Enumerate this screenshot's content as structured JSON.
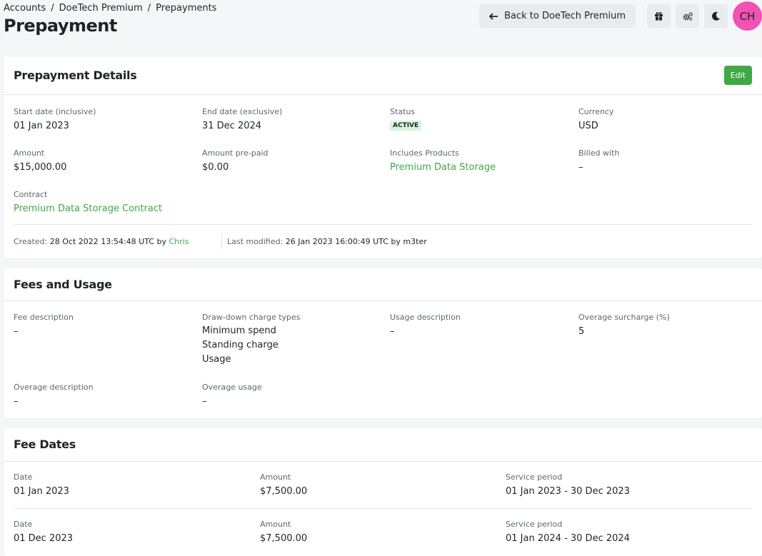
{
  "breadcrumb": [
    "Accounts",
    "DoeTech Premium",
    "Prepayments"
  ],
  "page_title": "Prepayment",
  "header": {
    "back_label": "Back to DoeTech Premium",
    "avatar_initials": "CH"
  },
  "details": {
    "title": "Prepayment Details",
    "edit_label": "Edit",
    "start_label": "Start date (inclusive)",
    "start_value": "01 Jan 2023",
    "end_label": "End date (exclusive)",
    "end_value": "31 Dec 2024",
    "status_label": "Status",
    "status_value": "ACTIVE",
    "currency_label": "Currency",
    "currency_value": "USD",
    "amount_label": "Amount",
    "amount_value": "$15,000.00",
    "prepaid_label": "Amount pre-paid",
    "prepaid_value": "$0.00",
    "products_label": "Includes Products",
    "products_value": "Premium Data Storage",
    "billed_label": "Billed with",
    "billed_value": "–",
    "contract_label": "Contract",
    "contract_value": "Premium Data Storage Contract",
    "created_label": "Created:",
    "created_value": "28 Oct 2022 13:54:48 UTC",
    "created_by_word": "by",
    "created_by": "Chris",
    "modified_label": "Last modified:",
    "modified_value": "26 Jan 2023 16:00:49 UTC by m3ter"
  },
  "fees": {
    "title": "Fees and Usage",
    "fee_desc_label": "Fee description",
    "fee_desc_value": "–",
    "drawdown_label": "Draw-down charge types",
    "drawdown_values": [
      "Minimum spend",
      "Standing charge",
      "Usage"
    ],
    "usage_desc_label": "Usage description",
    "usage_desc_value": "–",
    "surcharge_label": "Overage surcharge (%)",
    "surcharge_value": "5",
    "overage_desc_label": "Overage description",
    "overage_desc_value": "–",
    "overage_usage_label": "Overage usage",
    "overage_usage_value": "–"
  },
  "fee_dates": {
    "title": "Fee Dates",
    "rows": [
      {
        "date_label": "Date",
        "date": "01 Jan 2023",
        "amount_label": "Amount",
        "amount": "$7,500.00",
        "period_label": "Service period",
        "period": "01 Jan 2023 - 30 Dec 2023"
      },
      {
        "date_label": "Date",
        "date": "01 Dec 2023",
        "amount_label": "Amount",
        "amount": "$7,500.00",
        "period_label": "Service period",
        "period": "01 Jan 2024 - 30 Dec 2024"
      }
    ]
  },
  "colors": {
    "accent": "#40a845",
    "avatar": "#f152b4",
    "badge_bg": "#d6f5dc"
  },
  "icons": [
    "arrow-left-icon",
    "gift-icon",
    "gears-icon",
    "moon-icon"
  ]
}
